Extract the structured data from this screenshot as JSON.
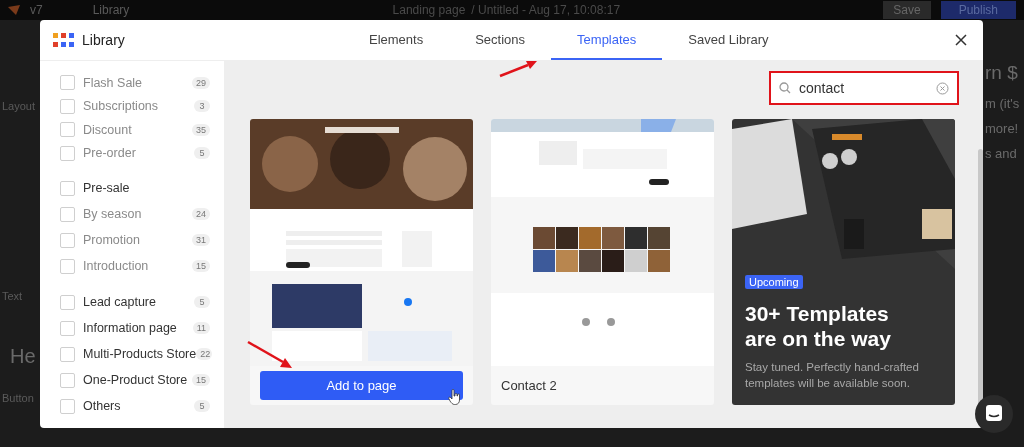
{
  "editor": {
    "brand": "v7",
    "library_label": "Library",
    "page_title": "Landing page",
    "document_title": "/ Untitled - Aug 17, 10:08:17",
    "save": "Save",
    "publish": "Publish",
    "left_labels": [
      "Layout",
      "Text",
      "Button"
    ],
    "heading_preview": "He",
    "right_lines": [
      "rn $",
      "m (it's",
      "more!",
      "s and"
    ]
  },
  "modal": {
    "title": "Library",
    "tabs": [
      {
        "label": "Elements",
        "selected": false
      },
      {
        "label": "Sections",
        "selected": false
      },
      {
        "label": "Templates",
        "selected": true
      },
      {
        "label": "Saved Library",
        "selected": false
      }
    ],
    "search": {
      "value": "contact"
    },
    "category_sections": [
      {
        "items": [
          {
            "kind": "child",
            "label": "Flash Sale",
            "count": "29",
            "checked": false
          },
          {
            "kind": "child",
            "label": "Subscriptions",
            "count": "3",
            "checked": false
          },
          {
            "kind": "child",
            "label": "Discount",
            "count": "35",
            "checked": false
          },
          {
            "kind": "child",
            "label": "Pre-order",
            "count": "5",
            "checked": false
          }
        ]
      },
      {
        "items": [
          {
            "kind": "parent",
            "label": "Pre-sale",
            "checked": false
          },
          {
            "kind": "child",
            "label": "By season",
            "count": "24",
            "checked": false
          },
          {
            "kind": "child",
            "label": "Promotion",
            "count": "31",
            "checked": false
          },
          {
            "kind": "child",
            "label": "Introduction",
            "count": "15",
            "checked": false
          }
        ]
      },
      {
        "items": [
          {
            "kind": "parent",
            "label": "Lead capture",
            "count": "5",
            "checked": false
          },
          {
            "kind": "parent",
            "label": "Information page",
            "count": "11",
            "checked": false
          },
          {
            "kind": "parent",
            "label": "Multi-Products Store",
            "count": "22",
            "checked": false
          },
          {
            "kind": "parent",
            "label": "One-Product Store",
            "count": "15",
            "checked": false
          },
          {
            "kind": "parent",
            "label": "Others",
            "count": "5",
            "checked": false
          }
        ]
      }
    ],
    "templates": [
      {
        "kind": "preview",
        "action": "Add to page"
      },
      {
        "kind": "preview",
        "name": "Contact 2"
      },
      {
        "kind": "upcoming",
        "badge": "Upcoming",
        "title": "30+ Templates are on the way",
        "description": "Stay tuned. Perfectly hand-crafted templates will be available soon."
      }
    ]
  }
}
